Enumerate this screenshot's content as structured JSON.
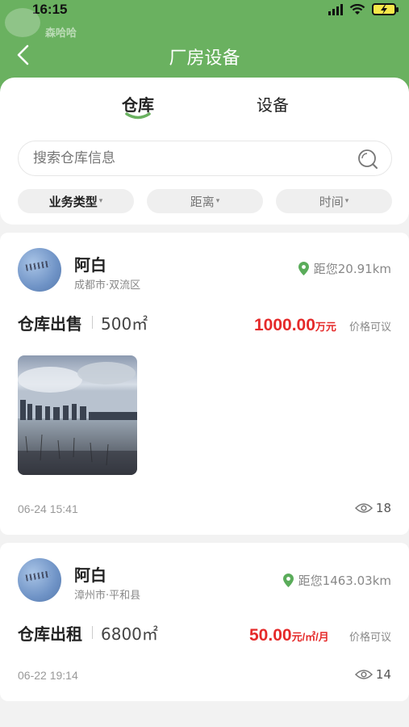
{
  "status_bar": {
    "time": "16:15"
  },
  "watermark": {
    "text": "森哈哈"
  },
  "header": {
    "title": "厂房设备"
  },
  "tabs": [
    {
      "label": "仓库",
      "active": true
    },
    {
      "label": "设备",
      "active": false
    }
  ],
  "search": {
    "placeholder": "搜索仓库信息"
  },
  "filters": [
    {
      "label": "业务类型"
    },
    {
      "label": "距离"
    },
    {
      "label": "时间"
    }
  ],
  "listings": [
    {
      "user": "阿白",
      "location": "成都市·双流区",
      "distance": "距您20.91km",
      "type": "仓库出售",
      "area": "500㎡",
      "price": "1000.00",
      "price_unit": "万元",
      "negotiable": "价格可议",
      "date": "06-24 15:41",
      "views": "18"
    },
    {
      "user": "阿白",
      "location": "漳州市·平和县",
      "distance": "距您1463.03km",
      "type": "仓库出租",
      "area": "6800㎡",
      "price": "50.00",
      "price_unit": "元/㎡/月",
      "negotiable": "价格可议",
      "date": "06-22 19:14",
      "views": "14"
    }
  ],
  "colors": {
    "brand_green": "#6ab160",
    "price_red": "#e52a2a"
  },
  "icons": [
    "back-arrow-icon",
    "search-icon",
    "location-pin-icon",
    "eye-icon",
    "signal-icon",
    "wifi-icon",
    "battery-icon"
  ]
}
